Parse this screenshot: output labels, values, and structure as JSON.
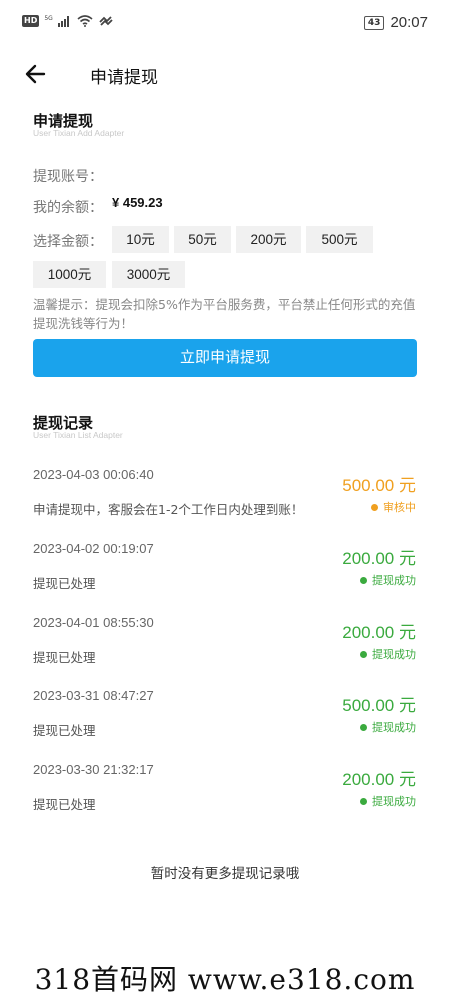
{
  "status_bar": {
    "network_badge": "HD",
    "signal_label": "5G",
    "battery": "43",
    "time": "20:07"
  },
  "nav": {
    "title": "申请提现"
  },
  "apply": {
    "title": "申请提现",
    "subtitle": "User Tixian Add Adapter",
    "account_label": "提现账号：",
    "balance_label": "我的余额：",
    "balance_value": "¥ 459.23",
    "amount_label": "选择金额：",
    "amounts": [
      "10元",
      "50元",
      "200元",
      "500元",
      "1000元",
      "3000元"
    ],
    "tip": "温馨提示：提现会扣除5%作为平台服务费，平台禁止任何形式的充值提现洗钱等行为！",
    "submit_label": "立即申请提现"
  },
  "records": {
    "title": "提现记录",
    "subtitle": "User Tixian List Adapter",
    "items": [
      {
        "date": "2023-04-03 00:06:40",
        "amount": "500.00 元",
        "desc": "申请提现中，客服会在1-2个工作日内处理到账！",
        "status": "审核中"
      },
      {
        "date": "2023-04-02 00:19:07",
        "amount": "200.00 元",
        "desc": "提现已处理",
        "status": "提现成功"
      },
      {
        "date": "2023-04-01 08:55:30",
        "amount": "200.00 元",
        "desc": "提现已处理",
        "status": "提现成功"
      },
      {
        "date": "2023-03-31 08:47:27",
        "amount": "500.00 元",
        "desc": "提现已处理",
        "status": "提现成功"
      },
      {
        "date": "2023-03-30 21:32:17",
        "amount": "200.00 元",
        "desc": "提现已处理",
        "status": "提现成功"
      }
    ],
    "no_more": "暂时没有更多提现记录哦"
  },
  "colors": {
    "accent": "#1aa3ec",
    "pending": "#f0a020",
    "success": "#3aaa3e"
  },
  "watermark": "318首码网  www.e318.com"
}
